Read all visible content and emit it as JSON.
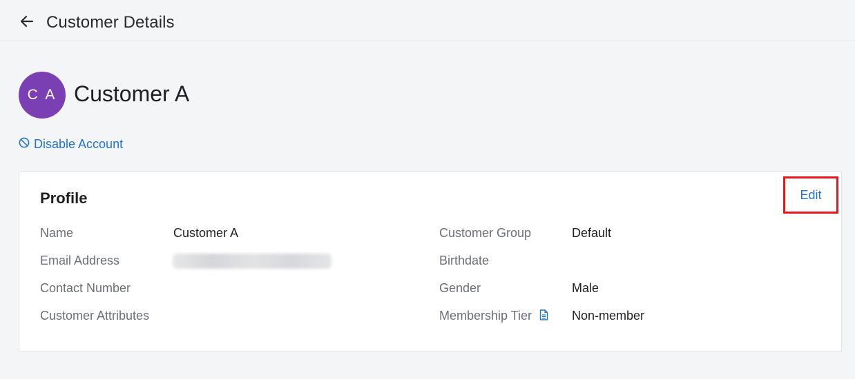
{
  "header": {
    "title": "Customer Details"
  },
  "customer": {
    "initials": "C A",
    "name": "Customer A",
    "avatar_color": "#7b3fb4"
  },
  "actions": {
    "disable_account": "Disable Account"
  },
  "profile": {
    "title": "Profile",
    "edit_label": "Edit",
    "left_fields": [
      {
        "label": "Name",
        "value": "Customer A"
      },
      {
        "label": "Email Address",
        "value": ""
      },
      {
        "label": "Contact Number",
        "value": ""
      },
      {
        "label": "Customer Attributes",
        "value": ""
      }
    ],
    "right_fields": [
      {
        "label": "Customer Group",
        "value": "Default"
      },
      {
        "label": "Birthdate",
        "value": ""
      },
      {
        "label": "Gender",
        "value": "Male"
      },
      {
        "label": "Membership Tier",
        "value": "Non-member"
      }
    ]
  },
  "colors": {
    "link": "#1f73d1",
    "highlight_border": "#e8141a",
    "background": "#f4f5f7"
  }
}
